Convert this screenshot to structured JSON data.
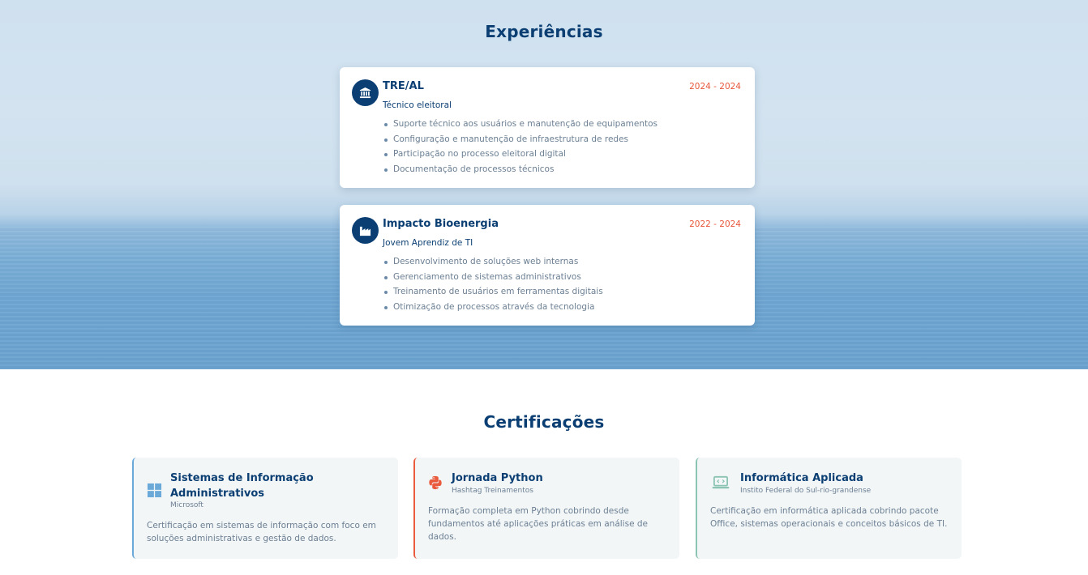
{
  "experiences": {
    "title": "Experiências",
    "items": [
      {
        "company": "TRE/AL",
        "date": "2024 - 2024",
        "role": "Técnico eleitoral",
        "icon": "bank-icon",
        "tasks": [
          "Suporte técnico aos usuários e manutenção de equipamentos",
          "Configuração e manutenção de infraestrutura de redes",
          "Participação no processo eleitoral digital",
          "Documentação de processos técnicos"
        ]
      },
      {
        "company": "Impacto Bioenergia",
        "date": "2022 - 2024",
        "role": "Jovem Aprendiz de TI",
        "icon": "factory-icon",
        "tasks": [
          "Desenvolvimento de soluções web internas",
          "Gerenciamento de sistemas administrativos",
          "Treinamento de usuários em ferramentas digitais",
          "Otimização de processos através da tecnologia"
        ]
      }
    ]
  },
  "certifications": {
    "title": "Certificações",
    "items": [
      {
        "name": "Sistemas de Informação Administrativos",
        "issuer": "Microsoft",
        "description": "Certificação em sistemas de informação com foco em soluções administrativas e gestão de dados.",
        "icon": "windows-icon",
        "accent": "#6aa9d8"
      },
      {
        "name": "Jornada Python",
        "issuer": "Hashtag Treinamentos",
        "description": "Formação completa em Python cobrindo desde fundamentos até aplicações práticas em análise de dados.",
        "icon": "python-icon",
        "accent": "#ea5a3c"
      },
      {
        "name": "Informática Aplicada",
        "issuer": "Instito Federal do Sul-rio-grandense",
        "description": "Certificação em informática aplicada cobrindo pacote Office, sistemas operacionais e conceitos básicos de TI.",
        "icon": "laptop-code-icon",
        "accent": "#8cc4b4"
      }
    ]
  },
  "colors": {
    "primary": "#0b3f73",
    "date": "#e8563a",
    "muted": "#6b7f93"
  }
}
